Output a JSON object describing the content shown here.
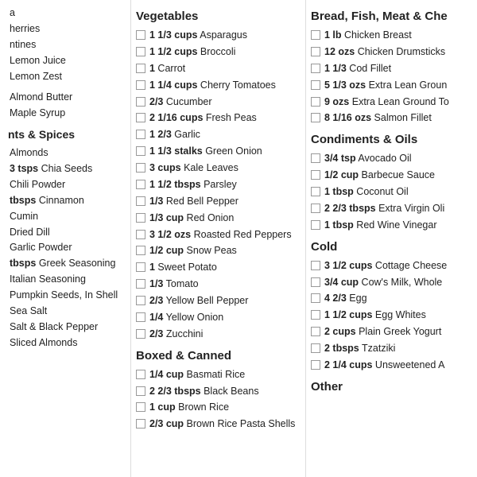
{
  "leftCol": {
    "items_top": [
      {
        "qty": "",
        "name": "a"
      },
      {
        "qty": "",
        "name": "herries"
      },
      {
        "qty": "",
        "name": "ntines"
      },
      {
        "qty": "",
        "name": "Lemon Juice"
      },
      {
        "qty": "",
        "name": "Lemon Zest"
      }
    ],
    "items_mid": [
      {
        "qty": "",
        "name": "Almond Butter"
      },
      {
        "qty": "",
        "name": "Maple Syrup"
      }
    ],
    "section2": "nts & Spices",
    "items_spices": [
      {
        "qty": "",
        "name": "Almonds"
      },
      {
        "qty": "3 tsps",
        "name": "Chia Seeds"
      },
      {
        "qty": "",
        "name": "Chili Powder"
      },
      {
        "qty": "tbsps",
        "name": "Cinnamon"
      },
      {
        "qty": "",
        "name": "Cumin"
      },
      {
        "qty": "",
        "name": "Dried Dill"
      },
      {
        "qty": "",
        "name": "Garlic Powder"
      },
      {
        "qty": "tbsps",
        "name": "Greek Seasoning"
      },
      {
        "qty": "",
        "name": "Italian Seasoning"
      },
      {
        "qty": "",
        "name": "Pumpkin Seeds, In Shell"
      },
      {
        "qty": "",
        "name": "Sea Salt"
      },
      {
        "qty": "",
        "name": "Salt & Black Pepper"
      },
      {
        "qty": "",
        "name": "Sliced Almonds"
      }
    ]
  },
  "midCol": {
    "section1": "Vegetables",
    "vegetables": [
      {
        "qty": "1 1/3 cups",
        "name": "Asparagus"
      },
      {
        "qty": "1 1/2 cups",
        "name": "Broccoli"
      },
      {
        "qty": "1",
        "name": "Carrot"
      },
      {
        "qty": "1 1/4 cups",
        "name": "Cherry Tomatoes"
      },
      {
        "qty": "2/3",
        "name": "Cucumber"
      },
      {
        "qty": "2 1/16 cups",
        "name": "Fresh Peas"
      },
      {
        "qty": "1 2/3",
        "name": "Garlic"
      },
      {
        "qty": "1 1/3 stalks",
        "name": "Green Onion"
      },
      {
        "qty": "3 cups",
        "name": "Kale Leaves"
      },
      {
        "qty": "1 1/2 tbsps",
        "name": "Parsley"
      },
      {
        "qty": "1/3",
        "name": "Red Bell Pepper"
      },
      {
        "qty": "1/3 cup",
        "name": "Red Onion"
      },
      {
        "qty": "3 1/2 ozs",
        "name": "Roasted Red Peppers"
      },
      {
        "qty": "1/2 cup",
        "name": "Snow Peas"
      },
      {
        "qty": "1",
        "name": "Sweet Potato"
      },
      {
        "qty": "1/3",
        "name": "Tomato"
      },
      {
        "qty": "2/3",
        "name": "Yellow Bell Pepper"
      },
      {
        "qty": "1/4",
        "name": "Yellow Onion"
      },
      {
        "qty": "2/3",
        "name": "Zucchini"
      }
    ],
    "section2": "Boxed & Canned",
    "boxed": [
      {
        "qty": "1/4 cup",
        "name": "Basmati Rice"
      },
      {
        "qty": "2 2/3 tbsps",
        "name": "Black Beans"
      },
      {
        "qty": "1 cup",
        "name": "Brown Rice"
      },
      {
        "qty": "2/3 cup",
        "name": "Brown Rice Pasta Shells"
      }
    ]
  },
  "rightCol": {
    "section1": "Bread, Fish, Meat & Che",
    "meat": [
      {
        "qty": "1 lb",
        "name": "Chicken Breast"
      },
      {
        "qty": "12 ozs",
        "name": "Chicken Drumsticks"
      },
      {
        "qty": "1 1/3",
        "name": "Cod Fillet"
      },
      {
        "qty": "5 1/3 ozs",
        "name": "Extra Lean Groun"
      },
      {
        "qty": "9 ozs",
        "name": "Extra Lean Ground To"
      },
      {
        "qty": "8 1/16 ozs",
        "name": "Salmon Fillet"
      }
    ],
    "section2": "Condiments & Oils",
    "condiments": [
      {
        "qty": "3/4 tsp",
        "name": "Avocado Oil"
      },
      {
        "qty": "1/2 cup",
        "name": "Barbecue Sauce"
      },
      {
        "qty": "1 tbsp",
        "name": "Coconut Oil"
      },
      {
        "qty": "2 2/3 tbsps",
        "name": "Extra Virgin Oli"
      },
      {
        "qty": "1 tbsp",
        "name": "Red Wine Vinegar"
      }
    ],
    "section3": "Cold",
    "cold": [
      {
        "qty": "3 1/2 cups",
        "name": "Cottage Cheese"
      },
      {
        "qty": "3/4 cup",
        "name": "Cow's Milk, Whole"
      },
      {
        "qty": "4 2/3",
        "name": "Egg"
      },
      {
        "qty": "1 1/2 cups",
        "name": "Egg Whites"
      },
      {
        "qty": "2 cups",
        "name": "Plain Greek Yogurt"
      },
      {
        "qty": "2 tbsps",
        "name": "Tzatziki"
      },
      {
        "qty": "2 1/4 cups",
        "name": "Unsweetened A"
      }
    ],
    "section4": "Other"
  }
}
